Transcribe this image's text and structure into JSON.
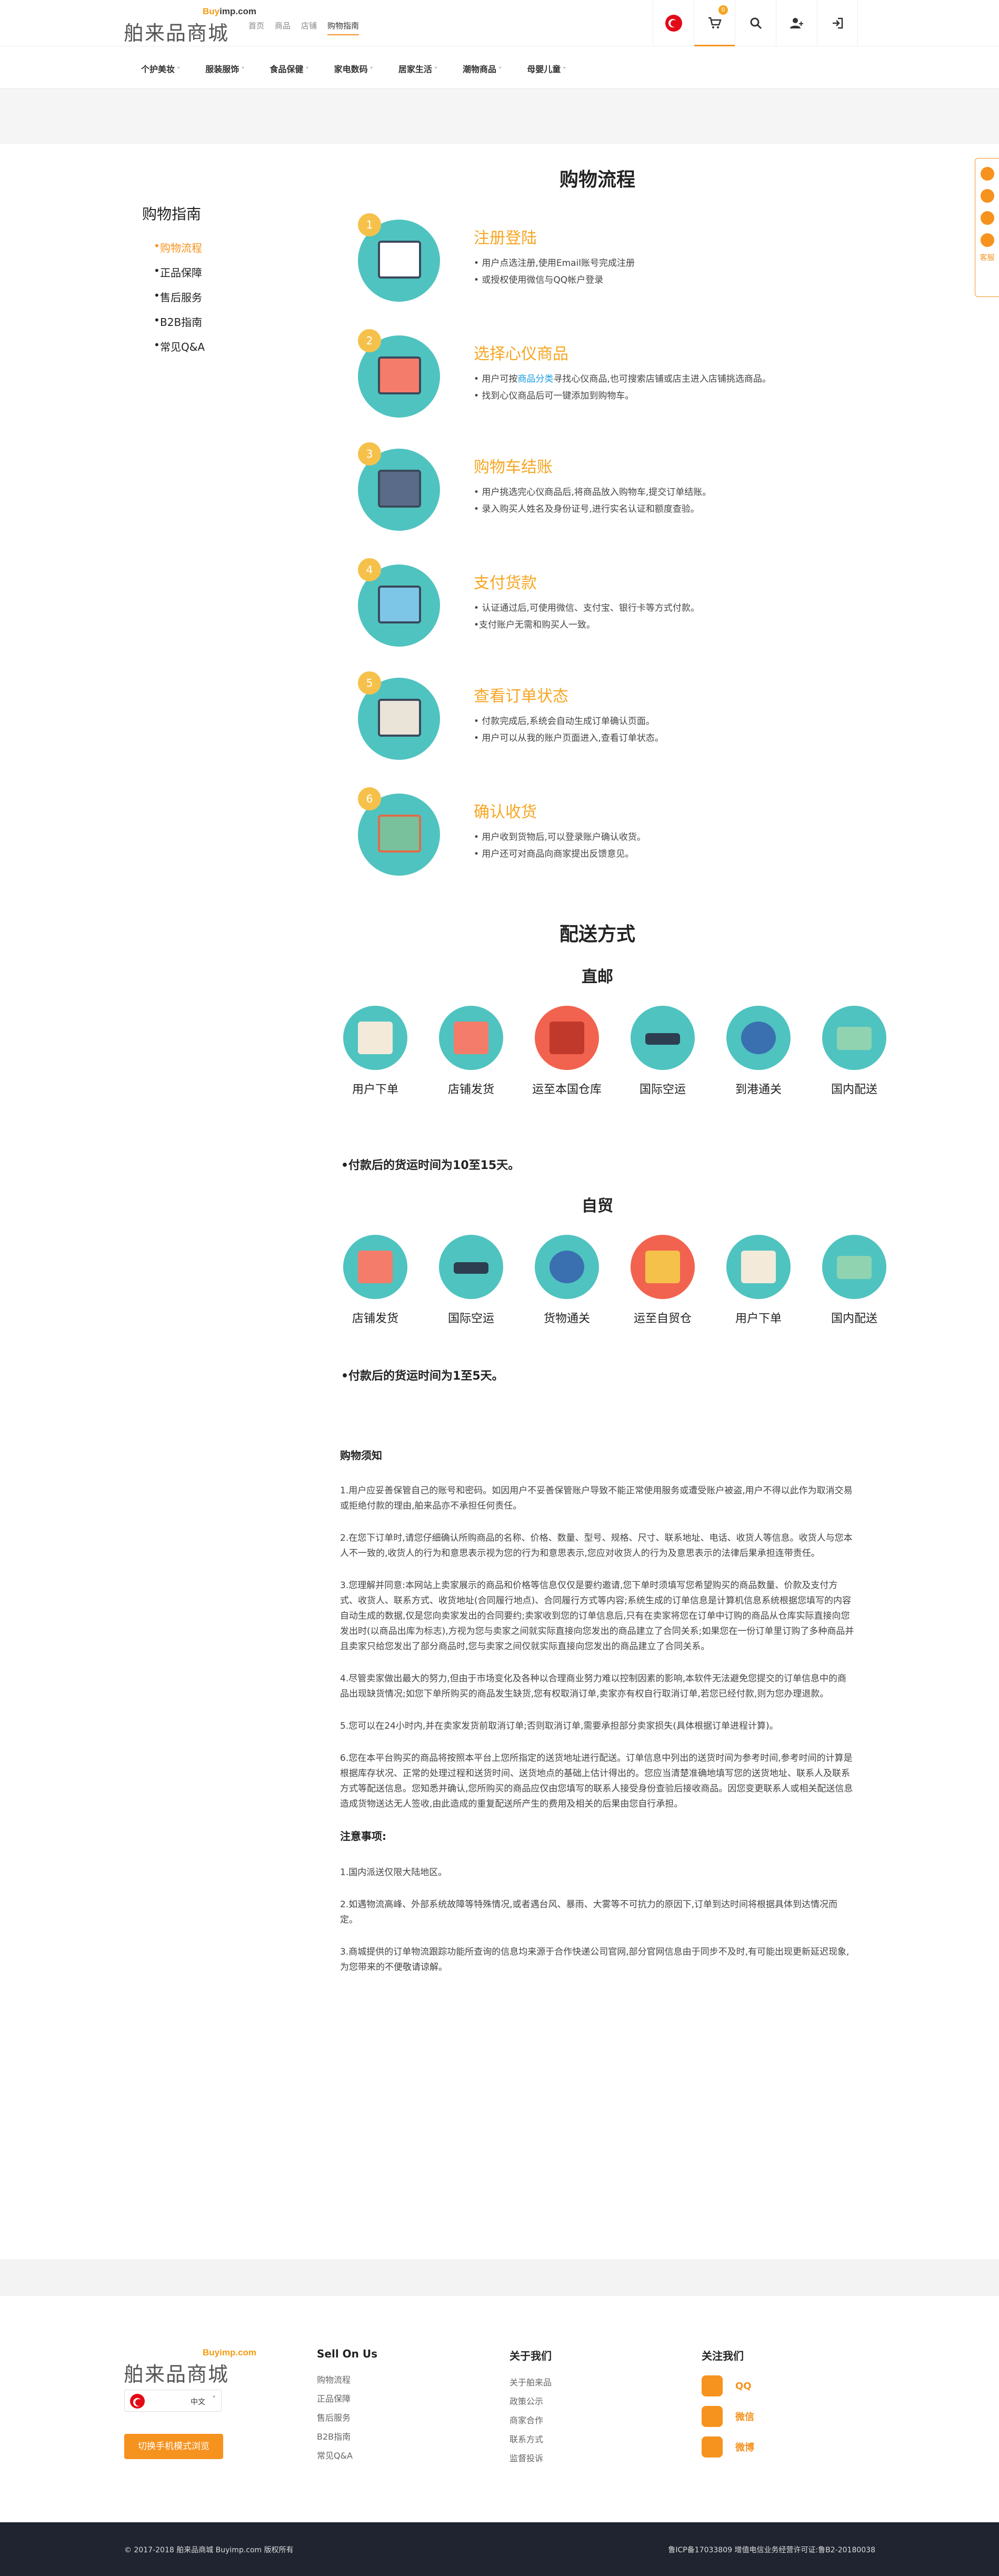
{
  "header": {
    "logo_en_a": "Buy",
    "logo_en_b": "imp.com",
    "logo_cn": "舶来品商城",
    "nav": [
      "首页",
      "商品",
      "店铺",
      "购物指南"
    ],
    "cart_count": "0",
    "categories": [
      "个护美妆",
      "服装服饰",
      "食品保健",
      "家电数码",
      "居家生活",
      "潮物商品",
      "母婴儿童"
    ]
  },
  "sidebar": {
    "title": "购物指南",
    "items": [
      "购物流程",
      "正品保障",
      "售后服务",
      "B2B指南",
      "常见Q&A"
    ]
  },
  "float_bar": {
    "label": "客服"
  },
  "process": {
    "title": "购物流程",
    "steps": [
      {
        "num": "1",
        "title": "注册登陆",
        "lines": [
          "• 用户点选注册,使用Email账号完成注册",
          "• 或授权使用微信与QQ帐户登录"
        ]
      },
      {
        "num": "2",
        "title": "选择心仪商品",
        "lines": [
          "• 用户可按",
          "商品分类",
          "寻找心仪商品,也可搜索店铺或店主进入店铺挑选商品。",
          "• 找到心仪商品后可一键添加到购物车。"
        ]
      },
      {
        "num": "3",
        "title": "购物车结账",
        "lines": [
          "• 用户挑选完心仪商品后,将商品放入购物车,提交订单结账。",
          "• 录入购买人姓名及身份证号,进行实名认证和额度查验。"
        ]
      },
      {
        "num": "4",
        "title": "支付货款",
        "lines": [
          "• 认证通过后,可使用微信、支付宝、银行卡等方式付款。",
          "•支付账户无需和购买人一致。"
        ]
      },
      {
        "num": "5",
        "title": "查看订单状态",
        "lines": [
          "• 付款完成后,系统会自动生成订单确认页面。",
          "• 用户可以从我的账户页面进入,查看订单状态。"
        ]
      },
      {
        "num": "6",
        "title": "确认收货",
        "lines": [
          "• 用户收到货物后,可以登录账户确认收货。",
          "• 用户还可对商品向商家提出反馈意见。"
        ]
      }
    ]
  },
  "shipping": {
    "title": "配送方式",
    "direct": {
      "title": "直邮",
      "items": [
        "用户下单",
        "店铺发货",
        "运至本国仓库",
        "国际空运",
        "到港通关",
        "国内配送"
      ],
      "note": "•付款后的货运时间为10至15天。"
    },
    "bonded": {
      "title": "自贸",
      "items": [
        "店铺发货",
        "国际空运",
        "货物通关",
        "运至自贸仓",
        "用户下单",
        "国内配送"
      ],
      "note": "•付款后的货运时间为1至5天。"
    }
  },
  "notice": {
    "title": "购物须知",
    "paras": [
      "1.用户应妥善保管自己的账号和密码。如因用户不妥善保管账户导致不能正常使用服务或遭受账户被盗,用户不得以此作为取消交易或拒绝付款的理由,舶来品亦不承担任何责任。",
      "2.在您下订单时,请您仔细确认所购商品的名称、价格、数量、型号、规格、尺寸、联系地址、电话、收货人等信息。收货人与您本人不一致的,收货人的行为和意思表示视为您的行为和意思表示,您应对收货人的行为及意思表示的法律后果承担连带责任。",
      "3.您理解并同意:本网站上卖家展示的商品和价格等信息仅仅是要约邀请,您下单时须填写您希望购买的商品数量、价款及支付方式、收货人、联系方式、收货地址(合同履行地点)、合同履行方式等内容;系统生成的订单信息是计算机信息系统根据您填写的内容自动生成的数据,仅是您向卖家发出的合同要约;卖家收到您的订单信息后,只有在卖家将您在订单中订购的商品从仓库实际直接向您发出时(以商品出库为标志),方视为您与卖家之间就实际直接向您发出的商品建立了合同关系;如果您在一份订单里订购了多种商品并且卖家只给您发出了部分商品时,您与卖家之间仅就实际直接向您发出的商品建立了合同关系。",
      "4.尽管卖家做出最大的努力,但由于市场变化及各种以合理商业努力难以控制因素的影响,本软件无法避免您提交的订单信息中的商品出现缺货情况;如您下单所购买的商品发生缺货,您有权取消订单,卖家亦有权自行取消订单,若您已经付款,则为您办理退款。",
      "5.您可以在24小时内,并在卖家发货前取消订单;否则取消订单,需要承担部分卖家损失(具体根据订单进程计算)。",
      "6.您在本平台购买的商品将按照本平台上您所指定的送货地址进行配送。订单信息中列出的送货时间为参考时间,参考时间的计算是根据库存状况、正常的处理过程和送货时间、送货地点的基础上估计得出的。您应当清楚准确地填写您的送货地址、联系人及联系方式等配送信息。您知悉并确认,您所购买的商品应仅由您填写的联系人接受身份查验后接收商品。因您变更联系人或相关配送信息造成货物送达无人签收,由此造成的重复配送所产生的费用及相关的后果由您自行承担。"
    ],
    "attention_title": "注意事项:",
    "attention": [
      "1.国内派送仅限大陆地区。",
      "2.如遇物流高峰、外部系统故障等特殊情况,或者遇台风、暴雨、大雾等不可抗力的原因下,订单到达时间将根据具体到达情况而定。",
      "3.商城提供的订单物流跟踪功能所查询的信息均来源于合作快递公司官网,部分官网信息由于同步不及时,有可能出现更新延迟现象,为您带来的不便敬请谅解。"
    ]
  },
  "footer": {
    "lang": "中文",
    "mobile_btn": "切换手机模式浏览",
    "col1": {
      "title": "Sell On Us",
      "items": [
        "购物流程",
        "正品保障",
        "售后服务",
        "B2B指南",
        "常见Q&A"
      ]
    },
    "col2": {
      "title": "关于我们",
      "items": [
        "关于舶来品",
        "政策公示",
        "商家合作",
        "联系方式",
        "监督投诉"
      ]
    },
    "col3": {
      "title": "关注我们",
      "items": [
        "QQ",
        "微信",
        "微博"
      ]
    },
    "copyright": "© 2017-2018 舶来品商城 Buyimp.com 版权所有",
    "icp": "鲁ICP备17033809 增值电信业务经营许可证:鲁B2-20180038"
  }
}
